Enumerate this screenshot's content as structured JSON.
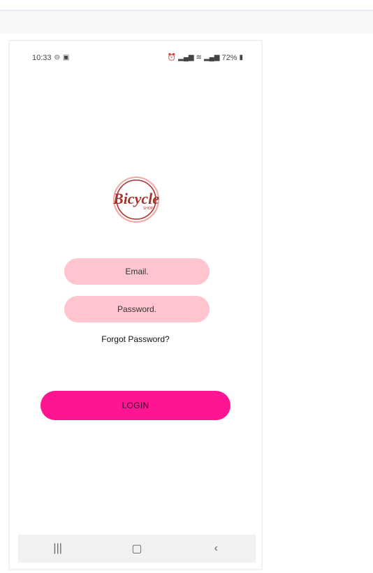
{
  "status_bar": {
    "time": "10:33",
    "battery": "72%",
    "left_icons": [
      "do-not-disturb-icon",
      "gallery-notification-icon"
    ],
    "right_icons": [
      "alarm-icon",
      "signal-icon",
      "wifi-calling-icon",
      "signal-icon",
      "battery-icon"
    ]
  },
  "logo": {
    "text": "Bicycle",
    "subtext": "SHOP",
    "colors": {
      "brand": "#a8332e",
      "ring": "#f2a7a4"
    }
  },
  "login_form": {
    "email_placeholder": "Email.",
    "password_placeholder": "Password.",
    "forgot_password_link": "Forgot Password?",
    "login_label": "LOGIN"
  },
  "navigation_bar": {
    "recents_icon": "recents-icon",
    "home_icon": "home-icon",
    "back_icon": "back-icon"
  },
  "colors": {
    "field_bg": "#ffc5ce",
    "login_bg": "#ff1493",
    "nav_bg": "#f1f1f1"
  }
}
